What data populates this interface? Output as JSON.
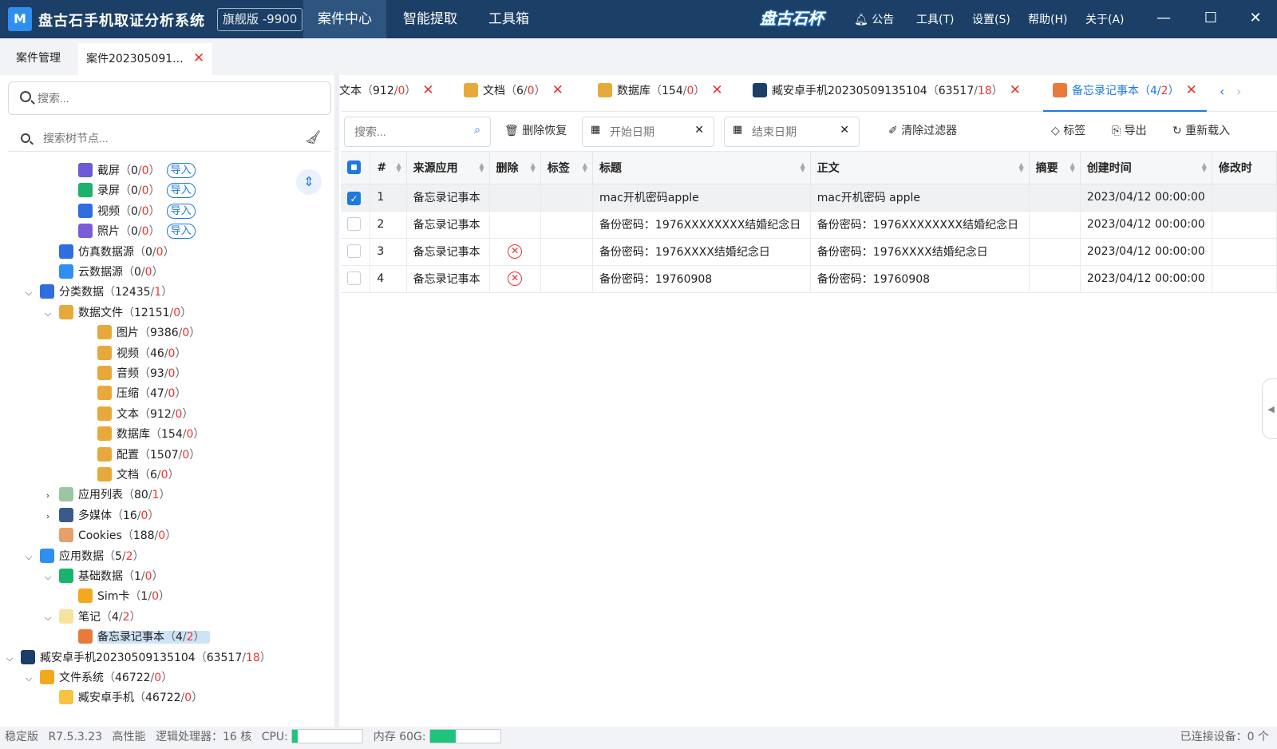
{
  "app": {
    "logo_letter": "M",
    "title": "盘古石手机取证分析系统",
    "edition": "旗舰版 -9900",
    "brand_text": "盘古石杯"
  },
  "main_nav": [
    "案件中心",
    "智能提取",
    "工具箱"
  ],
  "top_menu": [
    "公告",
    "工具(T)",
    "设置(S)",
    "帮助(H)",
    "关于(A)"
  ],
  "page_tabs": [
    {
      "label": "案件管理"
    },
    {
      "label": "案件202305091..."
    }
  ],
  "left": {
    "search_placeholder": "搜索...",
    "tree_search_placeholder": "搜索树节点..."
  },
  "tree": [
    {
      "label": "截屏",
      "count": "0",
      "red": "0",
      "import": "导入",
      "icon_color": "#6b5bd6"
    },
    {
      "label": "录屏",
      "count": "0",
      "red": "0",
      "import": "导入",
      "icon_color": "#19b36b"
    },
    {
      "label": "视频",
      "count": "0",
      "red": "0",
      "import": "导入",
      "icon_color": "#2f6de1"
    },
    {
      "label": "照片",
      "count": "0",
      "red": "0",
      "import": "导入",
      "icon_color": "#7b5bd6"
    },
    {
      "label": "仿真数据源",
      "count": "0",
      "red": "0",
      "icon_color": "#2f6de1"
    },
    {
      "label": "云数据源",
      "count": "0",
      "red": "0",
      "icon_color": "#2f8ff0"
    },
    {
      "label": "分类数据",
      "count": "12435",
      "red": "1",
      "icon_color": "#2f6de1"
    },
    {
      "label": "数据文件",
      "count": "12151",
      "red": "0",
      "icon_color": "#e8a93c"
    },
    {
      "label": "图片",
      "count": "9386",
      "red": "0",
      "icon_color": "#e8a93c"
    },
    {
      "label": "视频",
      "count": "46",
      "red": "0",
      "icon_color": "#e8a93c"
    },
    {
      "label": "音频",
      "count": "93",
      "red": "0",
      "icon_color": "#e8a93c"
    },
    {
      "label": "压缩",
      "count": "47",
      "red": "0",
      "icon_color": "#e8a93c"
    },
    {
      "label": "文本",
      "count": "912",
      "red": "0",
      "icon_color": "#e8a93c"
    },
    {
      "label": "数据库",
      "count": "154",
      "red": "0",
      "icon_color": "#e8a93c"
    },
    {
      "label": "配置",
      "count": "1507",
      "red": "0",
      "icon_color": "#e8a93c"
    },
    {
      "label": "文档",
      "count": "6",
      "red": "0",
      "icon_color": "#e8a93c"
    },
    {
      "label": "应用列表",
      "count": "80",
      "red": "1",
      "icon_color": "#9bc7a0"
    },
    {
      "label": "多媒体",
      "count": "16",
      "red": "0",
      "icon_color": "#3a5a8a"
    },
    {
      "label": "Cookies",
      "count": "188",
      "red": "0",
      "icon_color": "#e8a06a"
    },
    {
      "label": "应用数据",
      "count": "5",
      "red": "2",
      "icon_color": "#2f8ff0"
    },
    {
      "label": "基础数据",
      "count": "1",
      "red": "0",
      "icon_color": "#19b36b"
    },
    {
      "label": "Sim卡",
      "count": "1",
      "red": "0",
      "icon_color": "#f2a91e"
    },
    {
      "label": "笔记",
      "count": "4",
      "red": "2",
      "icon_color": "#f6e3a0"
    },
    {
      "label": "备忘录记事本",
      "count": "4",
      "red": "2",
      "icon_color": "#e87a3a"
    },
    {
      "label": "臧安卓手机20230509135104",
      "count": "63517",
      "red": "18",
      "icon_color": "#1b3f66"
    },
    {
      "label": "文件系统",
      "count": "46722",
      "red": "0",
      "icon_color": "#f2a91e"
    },
    {
      "label": "臧安卓手机",
      "count": "46722",
      "red": "0",
      "icon_color": "#f6c343"
    }
  ],
  "doc_tabs": [
    {
      "label": "文本",
      "count": "912",
      "red": "0",
      "icon_color": ""
    },
    {
      "label": "文档",
      "count": "6",
      "red": "0",
      "icon_color": "#e8a93c"
    },
    {
      "label": "数据库",
      "count": "154",
      "red": "0",
      "icon_color": "#e8a93c"
    },
    {
      "label": "臧安卓手机20230509135104",
      "count": "63517",
      "red": "18",
      "icon_color": "#1b3f66"
    },
    {
      "label": "备忘录记事本",
      "count": "4",
      "red": "2",
      "icon_color": "#e87a3a"
    }
  ],
  "toolbar": {
    "search_placeholder": "搜索...",
    "delete_restore": "删除恢复",
    "start_date_placeholder": "开始日期",
    "end_date_placeholder": "结束日期",
    "clear_filters": "清除过滤器",
    "tag": "标签",
    "export": "导出",
    "reload": "重新载入"
  },
  "table": {
    "columns": [
      "#",
      "来源应用",
      "删除",
      "标签",
      "标题",
      "正文",
      "摘要",
      "创建时间",
      "修改时"
    ],
    "rows": [
      {
        "num": "1",
        "app": "备忘录记事本",
        "deleted": false,
        "tag": "",
        "title": "mac开机密码apple",
        "body": "mac开机密码 apple",
        "summary": "",
        "created": "2023/04/12 00:00:00",
        "checked": true
      },
      {
        "num": "2",
        "app": "备忘录记事本",
        "deleted": false,
        "tag": "",
        "title": "备份密码：1976XXXXXXXX结婚纪念日",
        "body": "备份密码：1976XXXXXXXX结婚纪念日",
        "summary": "",
        "created": "2023/04/12 00:00:00",
        "checked": false
      },
      {
        "num": "3",
        "app": "备忘录记事本",
        "deleted": true,
        "tag": "",
        "title": "备份密码：1976XXXX结婚纪念日",
        "body": "备份密码：1976XXXX结婚纪念日",
        "summary": "",
        "created": "2023/04/12 00:00:00",
        "checked": false
      },
      {
        "num": "4",
        "app": "备忘录记事本",
        "deleted": true,
        "tag": "",
        "title": "备份密码：19760908",
        "body": "备份密码：19760908",
        "summary": "",
        "created": "2023/04/12 00:00:00",
        "checked": false
      }
    ]
  },
  "status": {
    "edition": "稳定版",
    "version": "R7.5.3.23",
    "perf": "高性能",
    "cpu_cores": "逻辑处理器：16 核",
    "cpu_label": "CPU:",
    "cpu_fraction": 0.08,
    "mem_label": "内存 60G:",
    "mem_fraction": 0.36,
    "devices": "已连接设备：0 个"
  },
  "colors": {
    "title_bar": "#1b3f66",
    "accent": "#1f7ae0",
    "count_red": "#e33333"
  }
}
